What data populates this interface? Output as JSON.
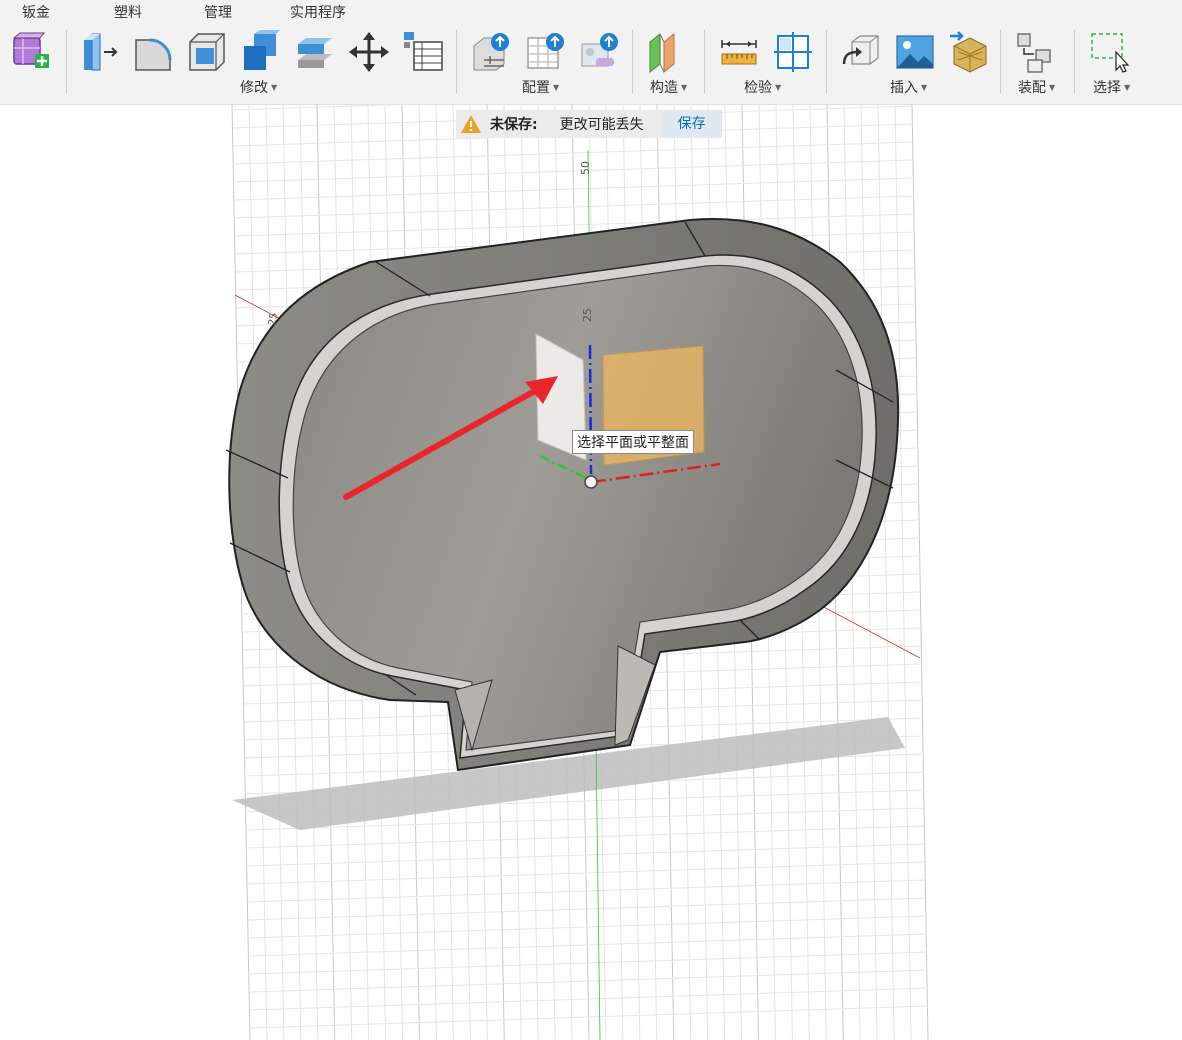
{
  "tabs": [
    "钣金",
    "塑料",
    "管理",
    "实用程序"
  ],
  "tools": [
    {
      "name": "new-component-icon"
    },
    {
      "name": "press-pull-icon"
    },
    {
      "name": "fillet-icon"
    },
    {
      "name": "shell-icon"
    },
    {
      "name": "combine-icon"
    },
    {
      "name": "offset-face-icon"
    },
    {
      "name": "move-icon"
    },
    {
      "name": "change-parameters-icon"
    },
    {
      "name": "configure-parameters-icon"
    },
    {
      "name": "configure-table-icon"
    },
    {
      "name": "configure-theme-icon"
    },
    {
      "name": "midplane-icon"
    },
    {
      "name": "measure-icon"
    },
    {
      "name": "section-analysis-icon"
    },
    {
      "name": "insert-derive-icon"
    },
    {
      "name": "insert-canvas-icon"
    },
    {
      "name": "insert-mesh-icon"
    },
    {
      "name": "assemble-joint-icon"
    },
    {
      "name": "select-window-icon"
    }
  ],
  "groups": {
    "modify": "修改",
    "configure": "配置",
    "construct": "构造",
    "inspect": "检验",
    "insert": "插入",
    "assemble": "装配",
    "select": "选择"
  },
  "notice": {
    "status": "未保存:",
    "message": "更改可能丢失",
    "save": "保存"
  },
  "tooltip": "选择平面或平整面",
  "ruler": {
    "mark_50": "50",
    "mark_25": "25",
    "mark_side": "25"
  },
  "colors": {
    "accent": "#0070b8",
    "x_axis": "#e02020",
    "y_axis": "#2ec82e",
    "z_axis": "#1a2adb",
    "arrow": "#e8262b",
    "plane": "#f0b860"
  }
}
